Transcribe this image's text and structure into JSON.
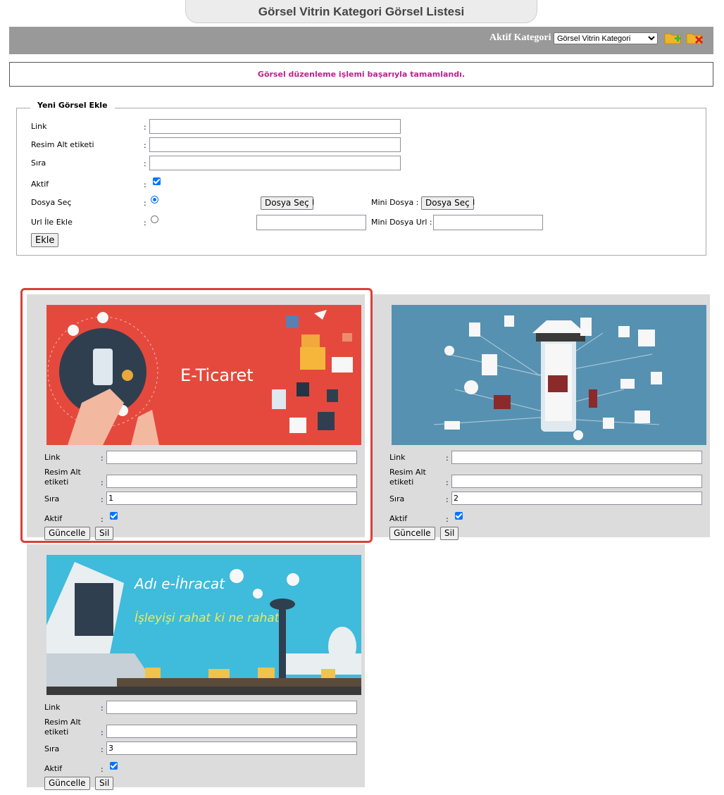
{
  "page_title": "Görsel Vitrin Kategori Görsel Listesi",
  "toolbar": {
    "active_label": "Aktif Kategori",
    "selected_category": "Görsel Vitrin Kategori",
    "add_icon": "folder-add-icon",
    "delete_icon": "folder-delete-icon"
  },
  "message": "Görsel düzenleme işlemi başarıyla tamamlandı.",
  "new_form": {
    "legend": "Yeni Görsel Ekle",
    "link_label": "Link",
    "alt_label": "Resim Alt etiketi",
    "order_label": "Sıra",
    "active_label": "Aktif",
    "file_label": "Dosya Seç",
    "url_label": "Url İle Ekle",
    "colon": ":",
    "file_button": "Dosya Seç",
    "mini_file_label": "Mini Dosya :",
    "mini_file_button": "Dosya Seç",
    "mini_url_label": "Mini Dosya Url :",
    "add_button": "Ekle",
    "link_value": "",
    "alt_value": "",
    "order_value": ""
  },
  "cards": [
    {
      "banner_text": "E-Ticaret",
      "link_label": "Link",
      "alt_label_1": "Resim Alt",
      "alt_label_2": "etiketi",
      "order_label": "Sıra",
      "active_label": "Aktif",
      "order_value": "1",
      "update_button": "Güncelle",
      "delete_button": "Sil",
      "colon": ":"
    },
    {
      "banner_text": "",
      "link_label": "Link",
      "alt_label_1": "Resim Alt",
      "alt_label_2": "etiketi",
      "order_label": "Sıra",
      "active_label": "Aktif",
      "order_value": "2",
      "update_button": "Güncelle",
      "delete_button": "Sil",
      "colon": ":"
    },
    {
      "banner_text_1": "Adı e-İhracat",
      "banner_text_2": "İşleyişi rahat ki ne rahat",
      "link_label": "Link",
      "alt_label_1": "Resim Alt",
      "alt_label_2": "etiketi",
      "order_label": "Sıra",
      "active_label": "Aktif",
      "order_value": "3",
      "update_button": "Güncelle",
      "delete_button": "Sil",
      "colon": ":"
    }
  ]
}
